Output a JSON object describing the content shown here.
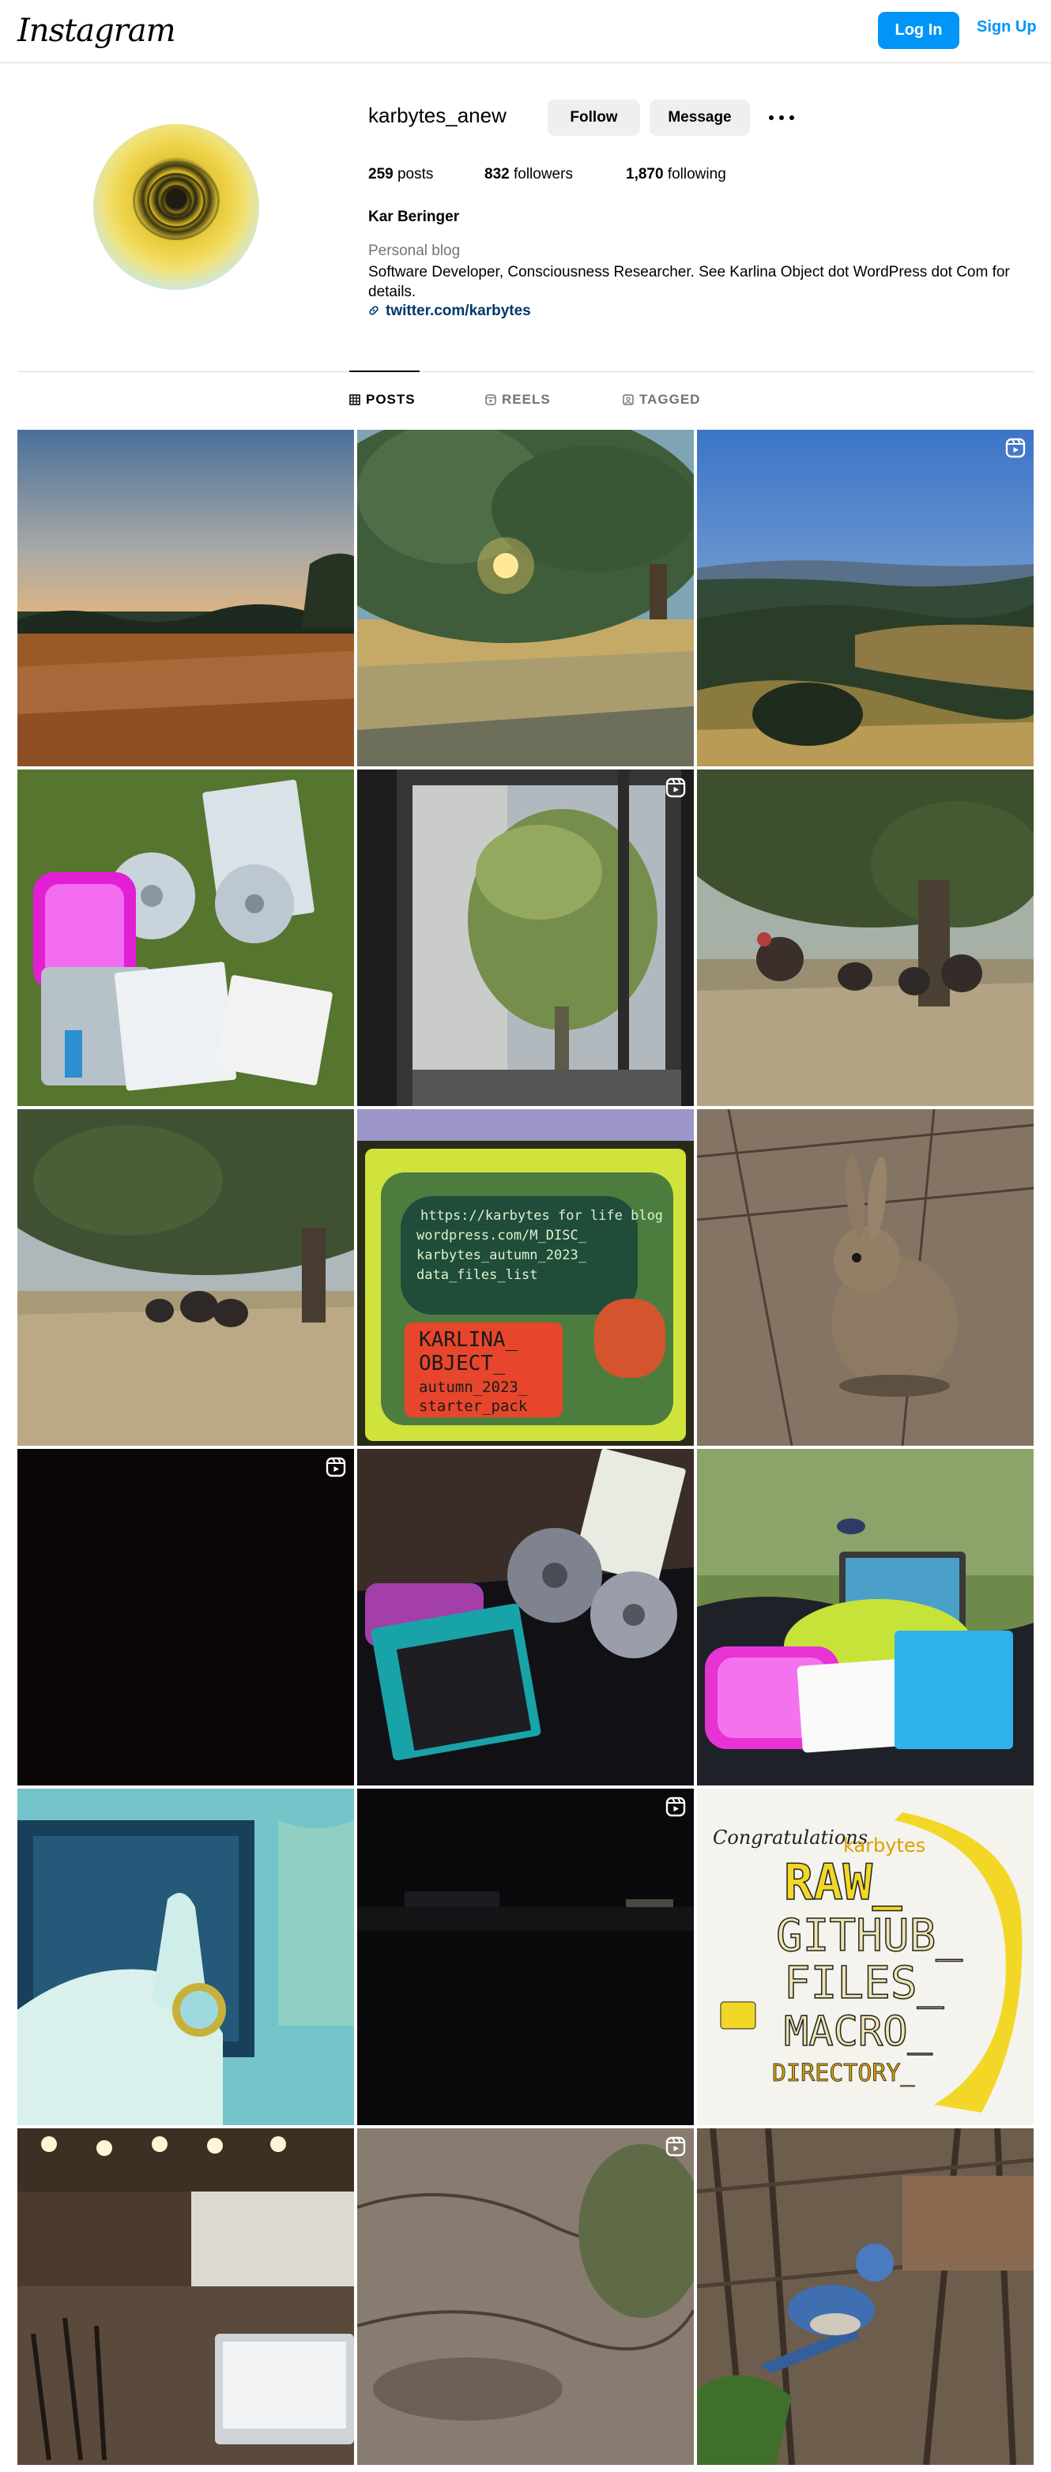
{
  "nav": {
    "logo": "Instagram",
    "login_label": "Log In",
    "signup_label": "Sign Up"
  },
  "profile": {
    "username": "karbytes_anew",
    "follow_label": "Follow",
    "message_label": "Message",
    "stats": {
      "posts_count": "259",
      "posts_label": "posts",
      "followers_count": "832",
      "followers_label": "followers",
      "following_count": "1,870",
      "following_label": "following"
    },
    "full_name": "Kar Beringer",
    "category": "Personal blog",
    "bio": "Software Developer, Consciousness Researcher. See Karlina Object dot WordPress dot Com for details.",
    "link": "twitter.com/karbytes"
  },
  "tabs": [
    {
      "label": "POSTS",
      "active": true,
      "icon": "grid-icon"
    },
    {
      "label": "REELS",
      "active": false,
      "icon": "reels-icon"
    },
    {
      "label": "TAGGED",
      "active": false,
      "icon": "tagged-icon"
    }
  ],
  "posts": [
    {
      "subject": "sunset-field",
      "reel": false
    },
    {
      "subject": "tree-sunburst",
      "reel": false
    },
    {
      "subject": "valley-view",
      "reel": true
    },
    {
      "subject": "discs-on-grass",
      "reel": false
    },
    {
      "subject": "window-tree",
      "reel": true
    },
    {
      "subject": "turkeys-under-tree",
      "reel": false
    },
    {
      "subject": "turkeys-shade",
      "reel": false
    },
    {
      "subject": "karlina-object-drawing",
      "reel": false
    },
    {
      "subject": "rabbit",
      "reel": false
    },
    {
      "subject": "dark-frame",
      "reel": true
    },
    {
      "subject": "discs-night",
      "reel": false
    },
    {
      "subject": "bird-backpack",
      "reel": false
    },
    {
      "subject": "hand-bottlecap",
      "reel": false
    },
    {
      "subject": "night-street",
      "reel": true
    },
    {
      "subject": "raw-github-drawing",
      "reel": false
    },
    {
      "subject": "cafe-laptop",
      "reel": false
    },
    {
      "subject": "ground-brush",
      "reel": true
    },
    {
      "subject": "scrub-jay",
      "reel": false
    }
  ],
  "drawing_text": {
    "karlina": [
      "https://karbytes for life blog",
      "wordpress.com/M_DISC_",
      "karbytes_autumn_2023_",
      "data_files_list",
      "KARLINA_",
      "OBJECT_",
      "autumn_2023_",
      "starter_pack"
    ],
    "raw": [
      "Congratulations",
      "karbytes",
      "RAW_",
      "GITHUB_",
      "FILES_",
      "MACRO_",
      "DIRECTORY_"
    ]
  },
  "colors": {
    "accent": "#0095f6",
    "link": "#00376b",
    "muted": "#737373",
    "divider": "#dbdbdb"
  }
}
